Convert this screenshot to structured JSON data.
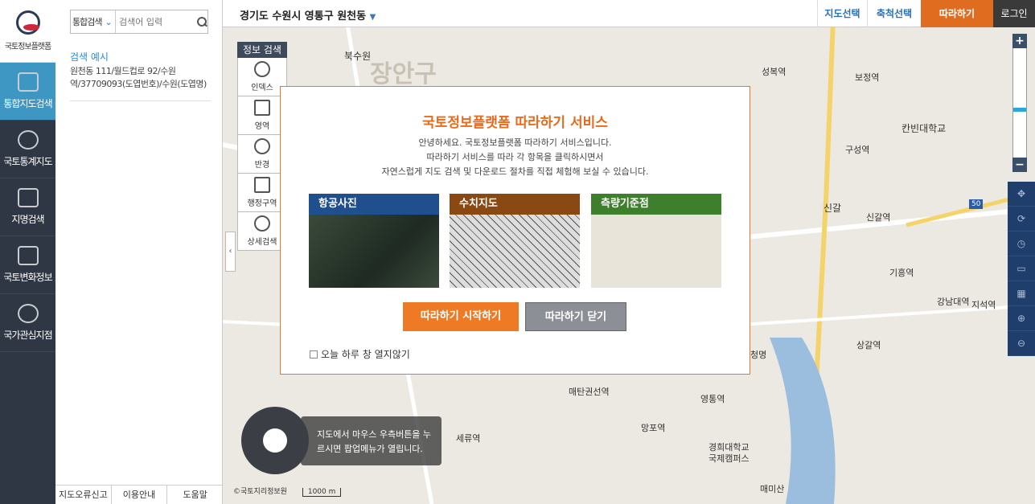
{
  "nav": {
    "logo_label": "국토정보플랫폼",
    "items": [
      {
        "label": "통합지도검색",
        "active": true,
        "icon": "map-search-icon"
      },
      {
        "label": "국토통계지도",
        "icon": "pie-chart-icon"
      },
      {
        "label": "지명검색",
        "icon": "place-name-icon"
      },
      {
        "label": "국토변화정보",
        "icon": "change-map-icon"
      },
      {
        "label": "국가관심지점",
        "icon": "target-point-icon"
      }
    ]
  },
  "panel": {
    "select_label": "통합검색",
    "search_placeholder": "검색어 입력",
    "example_title": "검색 예시",
    "example_body": "원천동 111/월드컵로 92/수원역/37709093(도엽번호)/수원(도엽명)",
    "footer": [
      "지도오류신고",
      "이용안내",
      "도움말"
    ]
  },
  "topbar": {
    "address": "경기도 수원시 영통구 원천동",
    "buttons": [
      "지도선택",
      "축척선택",
      "따라하기",
      "로그인"
    ]
  },
  "info": {
    "title": "정보 검색",
    "items": [
      "인덱스",
      "영역",
      "반경",
      "행정구역",
      "상세검색"
    ]
  },
  "map": {
    "labels": [
      "북수원",
      "장안구",
      "성복역",
      "보정역",
      "칸빈대학교",
      "구성역",
      "신갈",
      "신갈역",
      "기흥역",
      "지석역",
      "강남대역",
      "상갈역",
      "청명",
      "매탄권선역",
      "영통역",
      "망포역",
      "세류역",
      "경희대학교 국제캠퍼스",
      "매미산",
      "50"
    ],
    "tip": "지도에서 마우스 우측버튼을 누르시면 팝업메뉴가 열립니다.",
    "scale": "1000 m",
    "copyright": "©국토지리정보원"
  },
  "modal": {
    "title": "국토정보플랫폼 따라하기 서비스",
    "body": [
      "안녕하세요. 국토정보플랫폼 따라하기 서비스입니다.",
      "따라하기 서비스를 따라 각 항목을 클릭하시면서",
      "자연스럽게 지도 검색 및 다운로드 절차를 직접 체험해 보실 수 있습니다."
    ],
    "cards": [
      {
        "label": "항공사진",
        "color": "#1f4f8c"
      },
      {
        "label": "수치지도",
        "color": "#8a4812"
      },
      {
        "label": "측량기준점",
        "color": "#3d7f2a"
      }
    ],
    "start": "따라하기 시작하기",
    "close": "따라하기 닫기",
    "check": "오늘 하루 창 열지않기"
  }
}
